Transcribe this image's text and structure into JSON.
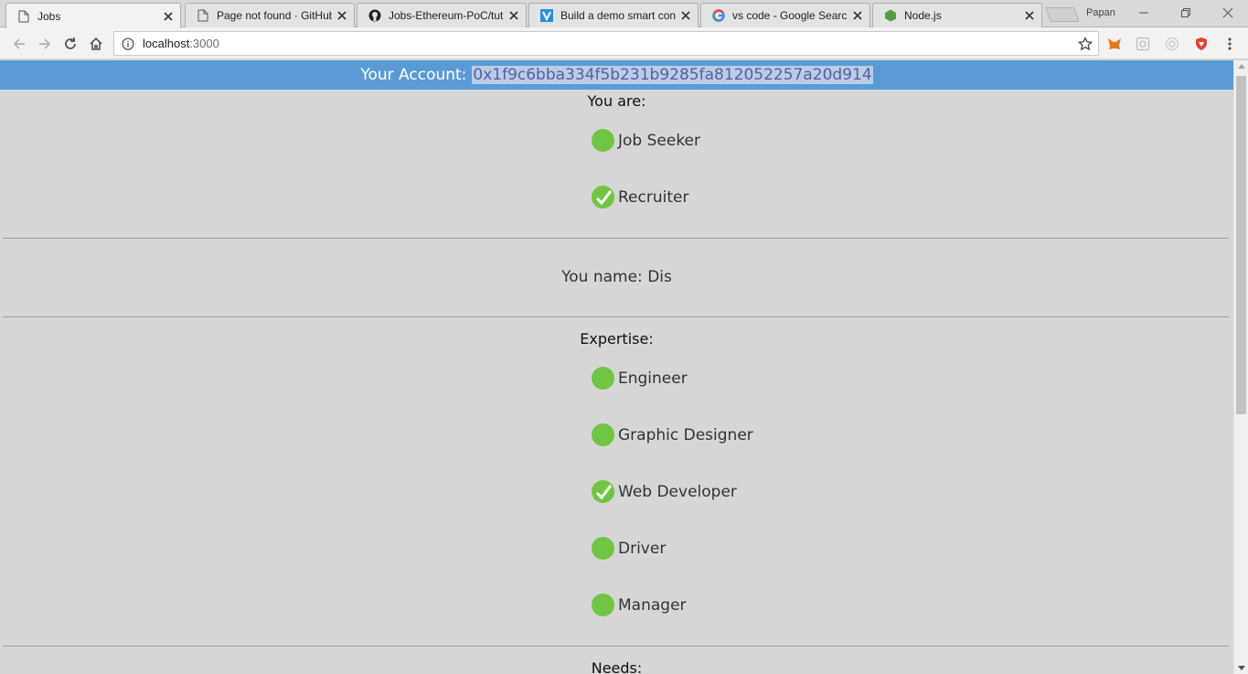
{
  "browser": {
    "tabs": [
      {
        "title": "Jobs",
        "icon": "page-icon",
        "active": true
      },
      {
        "title": "Page not found · GitHub",
        "icon": "page-icon",
        "active": false
      },
      {
        "title": "Jobs-Ethereum-PoC/tuto",
        "icon": "github-icon",
        "active": false
      },
      {
        "title": "Build a demo smart cont",
        "icon": "bookmark-logo-icon",
        "active": false
      },
      {
        "title": "vs code - Google Search",
        "icon": "google-icon",
        "active": false
      },
      {
        "title": "Node.js",
        "icon": "nodejs-icon",
        "active": false
      }
    ],
    "profile_name": "Papan",
    "url_host": "localhost",
    "url_port": ":3000"
  },
  "page": {
    "account_label": "Your Account:",
    "account_address": "0x1f9c6bba334f5b231b9285fa812052257a20d914",
    "role_title": "You are:",
    "roles": [
      {
        "label": "Job Seeker",
        "checked": false
      },
      {
        "label": "Recruiter",
        "checked": true
      }
    ],
    "name_line": "You name: Dis",
    "expertise_title": "Expertise:",
    "expertise": [
      {
        "label": "Engineer",
        "checked": false
      },
      {
        "label": "Graphic Designer",
        "checked": false
      },
      {
        "label": "Web Developer",
        "checked": true
      },
      {
        "label": "Driver",
        "checked": false
      },
      {
        "label": "Manager",
        "checked": false
      }
    ],
    "needs_title": "Needs:"
  },
  "colors": {
    "account_bar": "#5b9bd5",
    "radio_green": "#72c544",
    "page_bg": "#d6d6d6"
  }
}
